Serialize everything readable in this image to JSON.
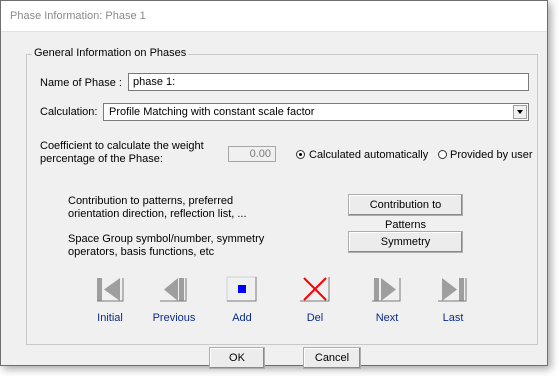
{
  "window": {
    "title": "Phase Information: Phase 1"
  },
  "group": {
    "label": "General Information on Phases"
  },
  "name_field": {
    "label": "Name of Phase :",
    "value": "phase 1:"
  },
  "calculation": {
    "label": "Calculation:",
    "selected": "Profile Matching with constant scale factor"
  },
  "coefficient": {
    "label_line1": "Coefficient to calculate the weight",
    "label_line2": "percentage of the Phase:",
    "value": "0.00",
    "option_auto": "Calculated automatically",
    "option_user": "Provided by user",
    "selected": "auto"
  },
  "contribution": {
    "desc_line1": "Contribution to patterns, preferred",
    "desc_line2": "orientation direction, reflection list, ...",
    "button": "Contribution to Patterns"
  },
  "symmetry": {
    "desc_line1": "Space Group symbol/number, symmetry",
    "desc_line2": "operators, basis functions, etc",
    "button": "Symmetry"
  },
  "nav": {
    "initial": "Initial",
    "previous": "Previous",
    "add": "Add",
    "del": "Del",
    "next": "Next",
    "last": "Last"
  },
  "footer": {
    "ok": "OK",
    "cancel": "Cancel"
  },
  "colors": {
    "nav_label": "#0a2c8a",
    "add_icon": "#0000ff",
    "del_icon": "#ff0000",
    "nav_icon": "#9e9e9e"
  }
}
